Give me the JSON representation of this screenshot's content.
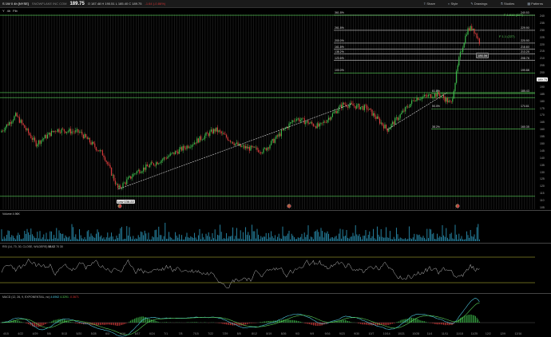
{
  "header": {
    "symbol": "S 1W 0 4h [NYSE]",
    "company": "SNOWFLAKE INC COM",
    "price": "189.75",
    "ohlc": "O 187.48 H 190.51 L 185.40 C 189.75",
    "change": "-1.64 (-0.86%)",
    "buttons": [
      {
        "label": "Share",
        "icon": "share-icon"
      },
      {
        "label": "Style",
        "icon": "style-icon"
      },
      {
        "label": "Drawings",
        "icon": "pencil-icon"
      },
      {
        "label": "Studies",
        "icon": "flask-icon"
      },
      {
        "label": "Patterns",
        "icon": "pattern-icon"
      }
    ]
  },
  "subbar": {
    "items": [
      "Y",
      "4h",
      "Fib"
    ]
  },
  "main": {
    "price_axis": [
      "240",
      "235",
      "230",
      "225",
      "220",
      "215",
      "210",
      "205",
      "200",
      "195",
      "190",
      "185",
      "180",
      "175",
      "170",
      "165",
      "160",
      "155",
      "150",
      "145",
      "140",
      "135",
      "130",
      "125",
      "120",
      "115",
      "110",
      "105"
    ],
    "fib_levels": [
      {
        "label": "361.8%",
        "price": "240.53"
      },
      {
        "label": "261.8%",
        "price": "229.90"
      },
      {
        "label": "200.0%",
        "price": "220.90"
      },
      {
        "label": "161.8%",
        "price": "216.60"
      },
      {
        "label": "138.2%",
        "price": "213.25"
      },
      {
        "label": "123.6%",
        "price": "208.76"
      },
      {
        "label": "100.0%",
        "price": "199.88"
      },
      {
        "label": "61.8%",
        "price": "185.43"
      },
      {
        "label": "50.0%",
        "price": "174.61"
      },
      {
        "label": "38.2%",
        "price": "160.35"
      }
    ],
    "badges": [
      {
        "text": "F 1.618 (227)",
        "color": "#59d159"
      },
      {
        "text": "F 1.1 (227)",
        "color": "#59d159"
      },
      {
        "text": "186.06",
        "color": "#59d159"
      },
      {
        "text": "189.75",
        "color": "#ffffff"
      }
    ],
    "annotations": [
      "E",
      "E",
      "E",
      "Low 136.22"
    ]
  },
  "volume": {
    "label": "Volume",
    "value": "4.96K"
  },
  "rsi": {
    "label": "RSI (14, 70, 30, CLOSE, WILDERS)",
    "value": "58.02",
    "levels": [
      "70",
      "30"
    ]
  },
  "macd": {
    "label": "MACD (12, 26, 9, EXPONENTIAL, no)",
    "values": [
      "4.6962",
      "4.3291",
      "-0.3671"
    ]
  },
  "dates": [
    "4/15",
    "4/22",
    "4/29",
    "5/6",
    "5/13",
    "5/20",
    "5/28",
    "6/3",
    "6/10",
    "6/17",
    "6/24",
    "7/1",
    "7/8",
    "7/15",
    "7/22",
    "7/29",
    "8/5",
    "8/12",
    "8/19",
    "8/26",
    "9/3",
    "9/9",
    "9/16",
    "9/23",
    "9/30",
    "10/7",
    "10/14",
    "10/21",
    "10/28",
    "11/4",
    "11/11",
    "11/18",
    "11/25",
    "12/2",
    "12/9",
    "12/16"
  ],
  "colors": {
    "up": "#3cb84a",
    "down": "#d33a3a",
    "fib": "#59d159",
    "macd_fast": "#4fc9e0",
    "macd_slow": "#59d159"
  }
}
